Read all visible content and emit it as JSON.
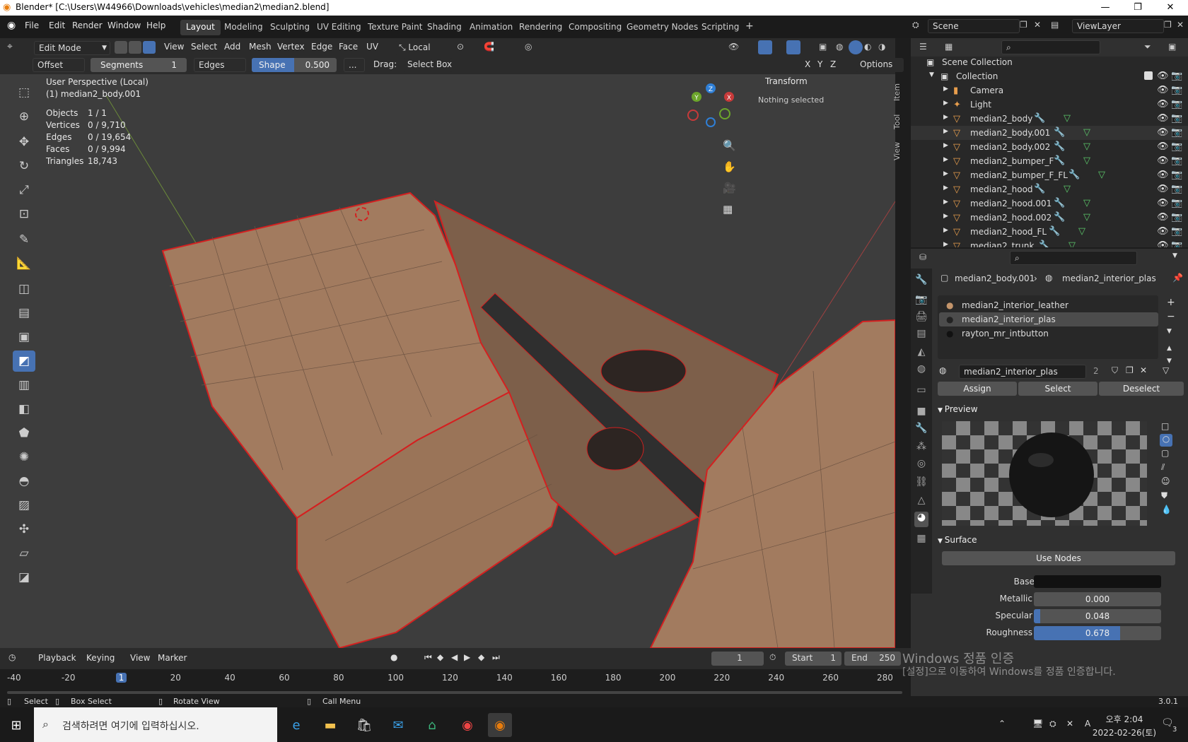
{
  "window": {
    "title": "Blender* [C:\\Users\\W44966\\Downloads\\vehicles\\median2\\median2.blend]"
  },
  "menus": [
    "File",
    "Edit",
    "Render",
    "Window",
    "Help"
  ],
  "workspaces": [
    "Layout",
    "Modeling",
    "Sculpting",
    "UV Editing",
    "Texture Paint",
    "Shading",
    "Animation",
    "Rendering",
    "Compositing",
    "Geometry Nodes",
    "Scripting"
  ],
  "active_workspace": "Layout",
  "scene": {
    "label": "Scene",
    "view_layer": "ViewLayer"
  },
  "viewport_header": {
    "mode": "Edit Mode",
    "menus": [
      "View",
      "Select",
      "Add",
      "Mesh",
      "Vertex",
      "Edge",
      "Face",
      "UV"
    ],
    "transform_orientation": "Local"
  },
  "operator_bar": {
    "offset": "Offset",
    "segments_label": "Segments",
    "segments_value": "1",
    "affect": "Edges",
    "shape_label": "Shape",
    "shape_value": "0.500",
    "shape_fraction": 0.5,
    "more": "...",
    "drag_label": "Drag:",
    "drag_value": "Select Box",
    "axes": [
      "X",
      "Y",
      "Z"
    ],
    "options": "Options"
  },
  "viewport": {
    "perspective": "User Perspective (Local)",
    "object": "(1) median2_body.001",
    "stats": [
      {
        "label": "Objects",
        "value": "1 / 1"
      },
      {
        "label": "Vertices",
        "value": "0 / 9,710"
      },
      {
        "label": "Edges",
        "value": "0 / 19,654"
      },
      {
        "label": "Faces",
        "value": "0 / 9,994"
      },
      {
        "label": "Triangles",
        "value": "18,743"
      }
    ],
    "npanel": {
      "header": "Transform",
      "body": "Nothing selected",
      "tabs": [
        "Item",
        "Tool",
        "View"
      ]
    },
    "gizmo": {
      "x": "X",
      "y": "Y",
      "z": "Z"
    }
  },
  "outliner": {
    "root": "Scene Collection",
    "collection": "Collection",
    "items": [
      "Camera",
      "Light",
      "median2_body",
      "median2_body.001",
      "median2_body.002",
      "median2_bumper_F",
      "median2_bumper_F_FL",
      "median2_hood",
      "median2_hood.001",
      "median2_hood.002",
      "median2_hood_FL",
      "median2_trunk"
    ]
  },
  "properties": {
    "breadcrumb_object": "median2_body.001",
    "breadcrumb_material": "median2_interior_plas",
    "slots": [
      "median2_interior_leather",
      "median2_interior_plas",
      "rayton_mr_intbutton"
    ],
    "selected_slot": 1,
    "material_name": "median2_interior_plas",
    "users": "2",
    "assign": "Assign",
    "select": "Select",
    "deselect": "Deselect",
    "preview_header": "Preview",
    "surface_header": "Surface",
    "use_nodes": "Use Nodes",
    "fields": [
      {
        "label": "Base Color",
        "value": ""
      },
      {
        "label": "Metallic",
        "value": "0.000",
        "fraction": 0.0
      },
      {
        "label": "Specular",
        "value": "0.048",
        "fraction": 0.048
      },
      {
        "label": "Roughness",
        "value": "0.678",
        "fraction": 0.678
      }
    ]
  },
  "timeline": {
    "menus": [
      "Playback",
      "Keying",
      "View",
      "Marker"
    ],
    "current_frame": "1",
    "start_label": "Start",
    "start": "1",
    "end_label": "End",
    "end": "250",
    "ticks": [
      "-40",
      "-20",
      "1",
      "20",
      "40",
      "60",
      "80",
      "100",
      "120",
      "140",
      "160",
      "180",
      "200",
      "220",
      "240",
      "260",
      "280"
    ]
  },
  "watermark": {
    "line1": "Windows 정품 인증",
    "line2": "[설정]으로 이동하여 Windows를 정품 인증합니다."
  },
  "statusbar": {
    "items": [
      "Select",
      "Box Select",
      "Rotate View",
      "Call Menu"
    ],
    "version": "3.0.1"
  },
  "taskbar": {
    "search_placeholder": "검색하려면 여기에 입력하십시오.",
    "time": "오후 2:04",
    "date": "2022-02-26(토)",
    "notifications": "3"
  },
  "colors": {
    "accent": "#4772b3",
    "mesh": "#a07a5c",
    "seam": "#d42020",
    "bg": "#3d3d3d"
  }
}
